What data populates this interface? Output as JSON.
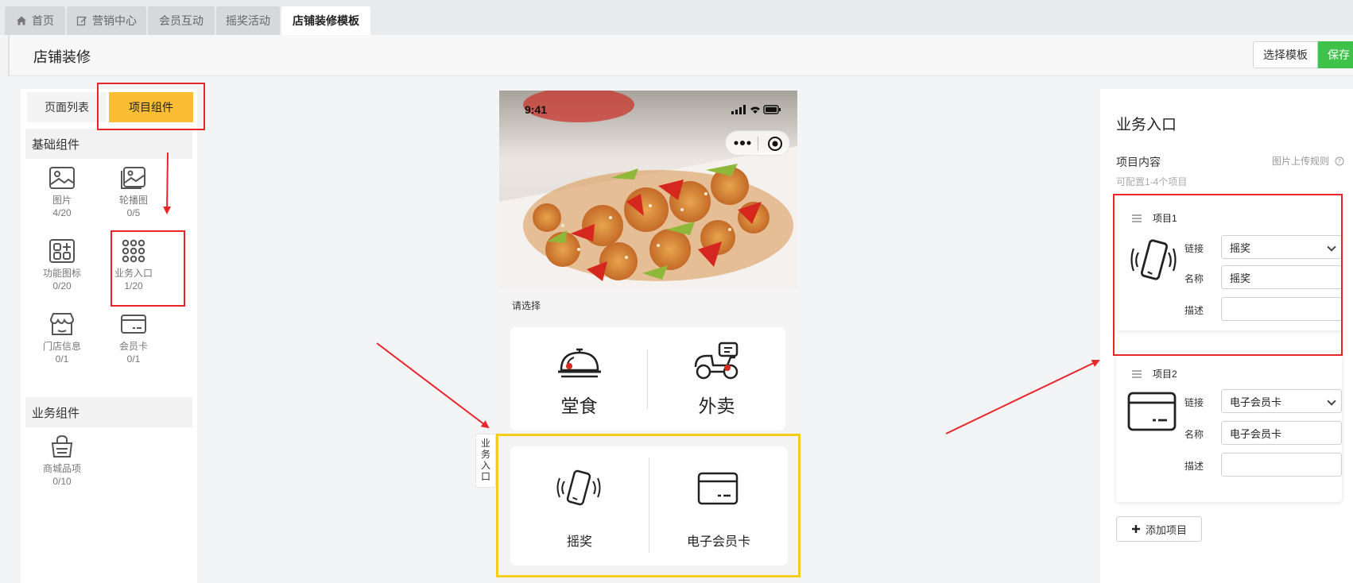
{
  "tabs": [
    {
      "label": "首页",
      "icon": "home-icon"
    },
    {
      "label": "营销中心",
      "icon": "edit-icon"
    },
    {
      "label": "会员互动"
    },
    {
      "label": "摇奖活动"
    },
    {
      "label": "店铺装修模板",
      "active": true
    }
  ],
  "header": {
    "title": "店铺装修",
    "select_template": "选择模板",
    "save": "保存"
  },
  "left": {
    "tabs": [
      "页面列表",
      "项目组件"
    ],
    "basic_title": "基础组件",
    "basic": [
      {
        "label": "图片",
        "count": "4/20",
        "icon": "image-icon"
      },
      {
        "label": "轮播图",
        "count": "0/5",
        "icon": "carousel-icon"
      },
      {
        "label": "功能图标",
        "count": "0/20",
        "icon": "function-icon"
      },
      {
        "label": "业务入口",
        "count": "1/20",
        "icon": "grid-icon"
      },
      {
        "label": "门店信息",
        "count": "0/1",
        "icon": "store-icon"
      },
      {
        "label": "会员卡",
        "count": "0/1",
        "icon": "card-icon"
      }
    ],
    "business_title": "业务组件",
    "business": [
      {
        "label": "商城品项",
        "count": "0/10",
        "icon": "basket-icon"
      }
    ]
  },
  "phone": {
    "time": "9:41",
    "select_label": "请选择",
    "dine": [
      "堂食",
      "外卖"
    ],
    "biz_items": [
      "摇奖",
      "电子会员卡"
    ],
    "side_tag": "业务入口"
  },
  "right": {
    "title": "业务入口",
    "content_label": "项目内容",
    "rule_link": "图片上传规则",
    "hint": "可配置1-4个项目",
    "items": [
      {
        "title": "项目1",
        "link_label": "链接",
        "link_value": "摇奖",
        "name_label": "名称",
        "name_value": "摇奖",
        "desc_label": "描述",
        "desc_value": "",
        "icon": "shake-phone-icon"
      },
      {
        "title": "项目2",
        "link_label": "链接",
        "link_value": "电子会员卡",
        "name_label": "名称",
        "name_value": "电子会员卡",
        "desc_label": "描述",
        "desc_value": "",
        "icon": "card-icon"
      }
    ],
    "add_button": "添加项目"
  },
  "colors": {
    "accent_yellow": "#fbbd33",
    "save_green": "#3fc24a",
    "annotation_red": "#e8262a",
    "highlight_yellow": "#f5cd1b"
  }
}
